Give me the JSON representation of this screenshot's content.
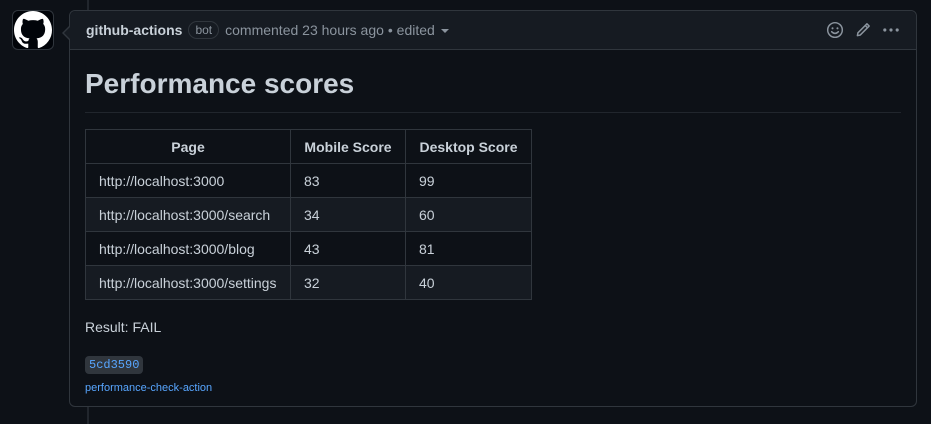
{
  "comment": {
    "author": "github-actions",
    "badge": "bot",
    "meta": "commented 23 hours ago",
    "edited": "• edited",
    "icons": [
      "github-logo-icon",
      "smiley-icon",
      "pencil-icon",
      "kebab-icon"
    ]
  },
  "body": {
    "heading": "Performance scores",
    "table": {
      "headers": [
        "Page",
        "Mobile Score",
        "Desktop Score"
      ],
      "rows": [
        [
          "http://localhost:3000",
          "83",
          "99"
        ],
        [
          "http://localhost:3000/search",
          "34",
          "60"
        ],
        [
          "http://localhost:3000/blog",
          "43",
          "81"
        ],
        [
          "http://localhost:3000/settings",
          "32",
          "40"
        ]
      ]
    },
    "result": "Result: FAIL",
    "sha": "5cd3590",
    "action_link": "performance-check-action"
  },
  "colors": {
    "background": "#0d1117",
    "header_bg": "#161b22",
    "border": "#30363d",
    "link": "#58a6ff"
  }
}
